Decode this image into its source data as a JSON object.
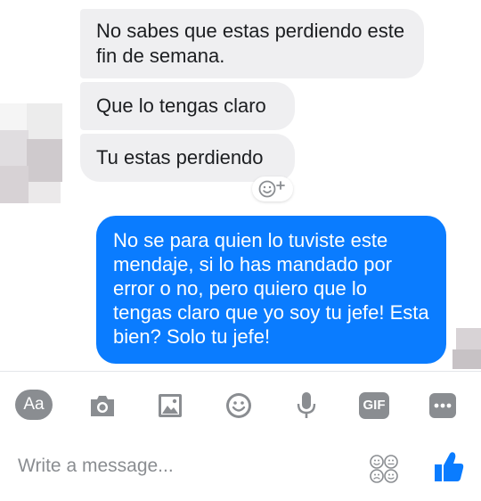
{
  "thread": {
    "incoming": [
      "No sabes que estas perdiendo este fin de semana.",
      "Que lo tengas claro",
      "Tu estas perdiendo"
    ],
    "outgoing": [
      "No se para quien lo tuviste este mendaje, si lo has mandado por error o no, pero quiero que lo tengas claro que yo soy tu jefe! Esta bien? Solo tu jefe!"
    ]
  },
  "toolbar": {
    "aa_label": "Aa",
    "icons": [
      "text-style-icon",
      "camera-icon",
      "gallery-icon",
      "emoji-icon",
      "microphone-icon",
      "gif-icon",
      "more-icon"
    ],
    "gif_label": "GIF"
  },
  "composer": {
    "placeholder": "Write a message...",
    "stickers_icon": "stickers-icon",
    "like_icon": "thumbs-up-icon"
  },
  "colors": {
    "accent": "#0a7cff",
    "incoming_bubble": "#efeff1",
    "icon_gray": "#8a8d91"
  }
}
